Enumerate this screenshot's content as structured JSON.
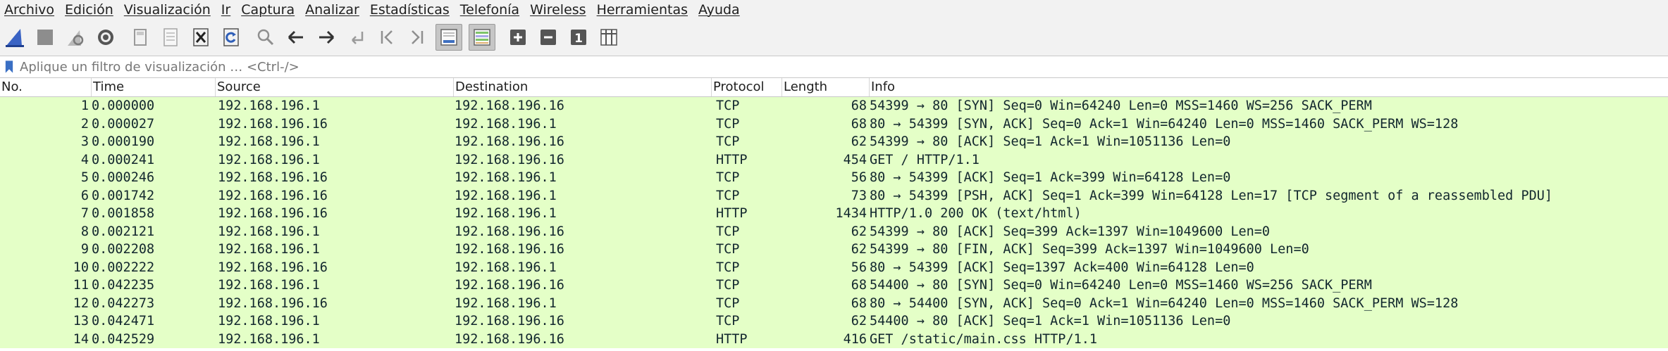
{
  "menu": [
    "Archivo",
    "Edición",
    "Visualización",
    "Ir",
    "Captura",
    "Analizar",
    "Estadísticas",
    "Telefonía",
    "Wireless",
    "Herramientas",
    "Ayuda"
  ],
  "filter": {
    "placeholder": "Aplique un filtro de visualización … <Ctrl-/>"
  },
  "columns": {
    "no": "No.",
    "time": "Time",
    "source": "Source",
    "destination": "Destination",
    "protocol": "Protocol",
    "length": "Length",
    "info": "Info"
  },
  "colors": {
    "row_tcp": "#e4ffc7",
    "row_http": "#e4ffc7",
    "accent_fin": "#2a5bd7"
  },
  "packets": [
    {
      "no": "1",
      "time": "0.000000",
      "source": "192.168.196.1",
      "destination": "192.168.196.16",
      "protocol": "TCP",
      "length": "68",
      "info": "54399 → 80 [SYN] Seq=0 Win=64240 Len=0 MSS=1460 WS=256 SACK_PERM"
    },
    {
      "no": "2",
      "time": "0.000027",
      "source": "192.168.196.16",
      "destination": "192.168.196.1",
      "protocol": "TCP",
      "length": "68",
      "info": "80 → 54399 [SYN, ACK] Seq=0 Ack=1 Win=64240 Len=0 MSS=1460 SACK_PERM WS=128"
    },
    {
      "no": "3",
      "time": "0.000190",
      "source": "192.168.196.1",
      "destination": "192.168.196.16",
      "protocol": "TCP",
      "length": "62",
      "info": "54399 → 80 [ACK] Seq=1 Ack=1 Win=1051136 Len=0"
    },
    {
      "no": "4",
      "time": "0.000241",
      "source": "192.168.196.1",
      "destination": "192.168.196.16",
      "protocol": "HTTP",
      "length": "454",
      "info": "GET / HTTP/1.1"
    },
    {
      "no": "5",
      "time": "0.000246",
      "source": "192.168.196.16",
      "destination": "192.168.196.1",
      "protocol": "TCP",
      "length": "56",
      "info": "80 → 54399 [ACK] Seq=1 Ack=399 Win=64128 Len=0"
    },
    {
      "no": "6",
      "time": "0.001742",
      "source": "192.168.196.16",
      "destination": "192.168.196.1",
      "protocol": "TCP",
      "length": "73",
      "info": "80 → 54399 [PSH, ACK] Seq=1 Ack=399 Win=64128 Len=17 [TCP segment of a reassembled PDU]"
    },
    {
      "no": "7",
      "time": "0.001858",
      "source": "192.168.196.16",
      "destination": "192.168.196.1",
      "protocol": "HTTP",
      "length": "1434",
      "info": "HTTP/1.0 200 OK  (text/html)"
    },
    {
      "no": "8",
      "time": "0.002121",
      "source": "192.168.196.1",
      "destination": "192.168.196.16",
      "protocol": "TCP",
      "length": "62",
      "info": "54399 → 80 [ACK] Seq=399 Ack=1397 Win=1049600 Len=0"
    },
    {
      "no": "9",
      "time": "0.002208",
      "source": "192.168.196.1",
      "destination": "192.168.196.16",
      "protocol": "TCP",
      "length": "62",
      "info": "54399 → 80 [FIN, ACK] Seq=399 Ack=1397 Win=1049600 Len=0"
    },
    {
      "no": "10",
      "time": "0.002222",
      "source": "192.168.196.16",
      "destination": "192.168.196.1",
      "protocol": "TCP",
      "length": "56",
      "info": "80 → 54399 [ACK] Seq=1397 Ack=400 Win=64128 Len=0"
    },
    {
      "no": "11",
      "time": "0.042235",
      "source": "192.168.196.1",
      "destination": "192.168.196.16",
      "protocol": "TCP",
      "length": "68",
      "info": "54400 → 80 [SYN] Seq=0 Win=64240 Len=0 MSS=1460 WS=256 SACK_PERM"
    },
    {
      "no": "12",
      "time": "0.042273",
      "source": "192.168.196.16",
      "destination": "192.168.196.1",
      "protocol": "TCP",
      "length": "68",
      "info": "80 → 54400 [SYN, ACK] Seq=0 Ack=1 Win=64240 Len=0 MSS=1460 SACK_PERM WS=128"
    },
    {
      "no": "13",
      "time": "0.042471",
      "source": "192.168.196.1",
      "destination": "192.168.196.16",
      "protocol": "TCP",
      "length": "62",
      "info": "54400 → 80 [ACK] Seq=1 Ack=1 Win=1051136 Len=0"
    },
    {
      "no": "14",
      "time": "0.042529",
      "source": "192.168.196.1",
      "destination": "192.168.196.16",
      "protocol": "HTTP",
      "length": "416",
      "info": "GET /static/main.css HTTP/1.1"
    }
  ]
}
